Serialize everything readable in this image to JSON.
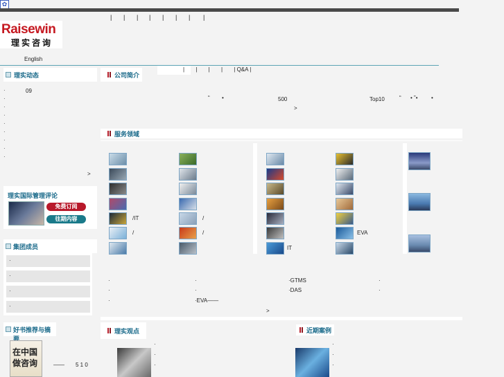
{
  "favicon": "paw-icon",
  "nav": {
    "separators": [
      "|",
      "|",
      "|",
      "|",
      "|",
      "|",
      "|",
      "|"
    ]
  },
  "logo": {
    "en": "Raisewin",
    "cn": "理实咨询"
  },
  "language": "English",
  "sub_nav": {
    "items": [
      "|",
      "|",
      "|",
      "|",
      "|",
      "Q&A",
      "|"
    ]
  },
  "news": {
    "title": "理实动态",
    "bullets": [
      "·",
      "·",
      "·",
      "·",
      "·",
      "·",
      "·",
      "·",
      "·"
    ],
    "first_text": "09",
    "more": ">"
  },
  "about": {
    "title": "公司简介",
    "t1": "“",
    "t2": "•",
    "t3": "500",
    "t4": "Top10",
    "t5": "“",
    "t6": "• ”•",
    "t7": "•",
    "more": ">"
  },
  "services": {
    "title": "服务领域",
    "labels": [
      "/IT",
      "/",
      "/",
      "/",
      "EVA",
      "IT"
    ],
    "bottom": [
      "·",
      "·",
      "·",
      "·",
      "·",
      "·",
      "·GTMS",
      "·DAS",
      "·",
      "·",
      "·EVA——"
    ],
    "more": ">"
  },
  "review": {
    "title": "理实国际管理评论",
    "subscribe": "免费订阅",
    "archive": "往期内容"
  },
  "members": {
    "title": "集团成员",
    "items": [
      "·",
      "·",
      "·",
      "·"
    ]
  },
  "books": {
    "title": "好书推荐与摘要",
    "cover": "在中国做咨询",
    "dash": "——",
    "num": "5 1 0"
  },
  "views": {
    "title": "理实观点",
    "dots": [
      "·",
      "·",
      "·"
    ]
  },
  "cases": {
    "title": "近期案例",
    "dots": [
      "·",
      "·",
      "·"
    ]
  },
  "colors": {
    "accent": "#1a6a8a",
    "brand_red": "#c51820",
    "topbar": "#4a4a4a"
  }
}
